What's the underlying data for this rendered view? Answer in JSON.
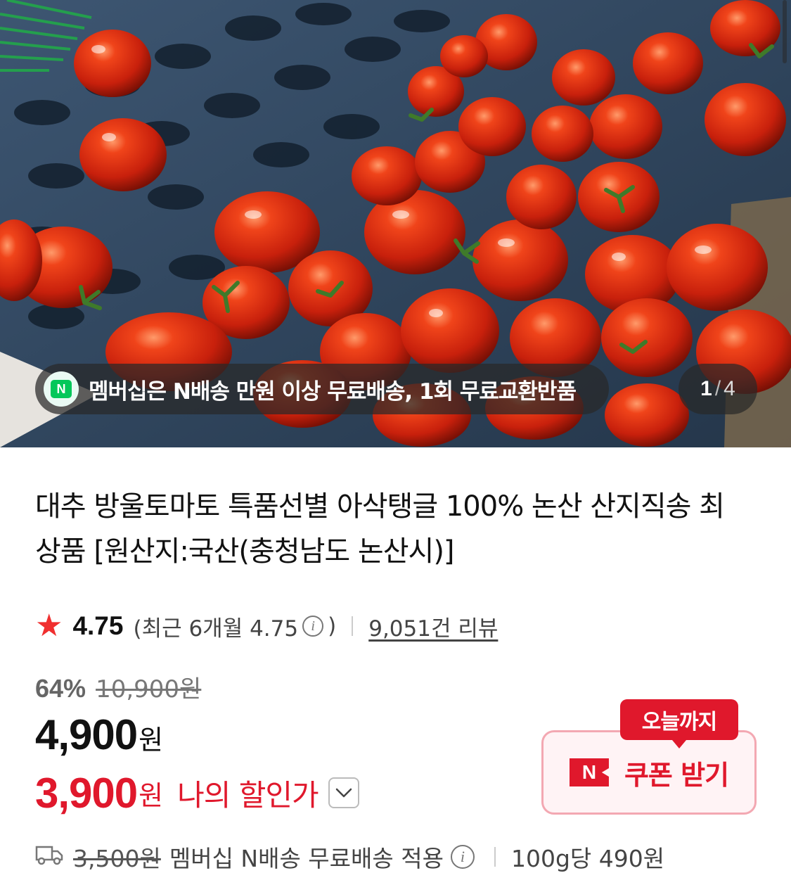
{
  "banner": {
    "shipping_text": "멤버십은 N배송 만원 이상 무료배송, 1회 무료교환반품",
    "n_badge": "N",
    "pager_current": "1",
    "pager_separator": "/",
    "pager_total": "4"
  },
  "product": {
    "title": "대추 방울토마토 특품선별 아삭탱글 100% 논산 산지직송 최상품 [원산지:국산(충청남도 논산시)]"
  },
  "rating": {
    "score": "4.75",
    "recent_open": "(최근 6개월 4.75",
    "recent_close": ")",
    "reviews": "9,051건 리뷰"
  },
  "price": {
    "discount_rate": "64%",
    "original": "10,900원",
    "sale": "4,900",
    "currency": "원",
    "my_price": "3,900",
    "my_label": "나의 할인가"
  },
  "coupon": {
    "tag": "오늘까지",
    "badge": "N",
    "label": "쿠폰 받기"
  },
  "shipping": {
    "old_fee": "3,500원",
    "text": "멤버십 N배송 무료배송 적용",
    "unit_price": "100g당 490원"
  },
  "colors": {
    "accent_red": "#e0182c",
    "naver_green": "#03c75a"
  }
}
